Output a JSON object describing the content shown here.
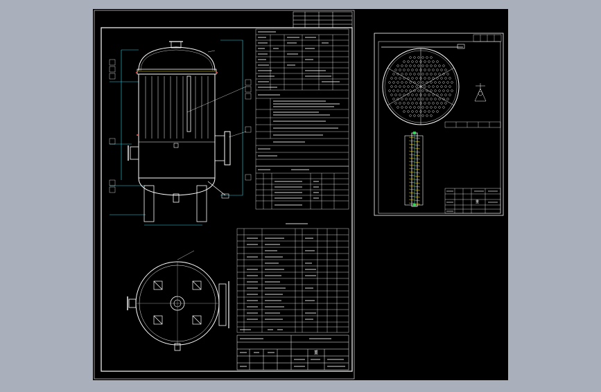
{
  "canvas": {
    "background": "#a9b0bb",
    "paper": "#000000"
  },
  "colors": {
    "white": "#ffffff",
    "cyan": "#2ad4e6",
    "yellow": "#e6d21a",
    "red": "#e23a3a",
    "green": "#3bd45a"
  },
  "icons": [
    "pressure-vessel-elevation",
    "vessel-plan-view",
    "tube-sheet-plan",
    "tube-bundle-section",
    "detail-callout"
  ],
  "sheet1": {
    "title_block_label": "重",
    "note": "技术特性表"
  },
  "sheet2": {
    "title_block_label": "重"
  }
}
